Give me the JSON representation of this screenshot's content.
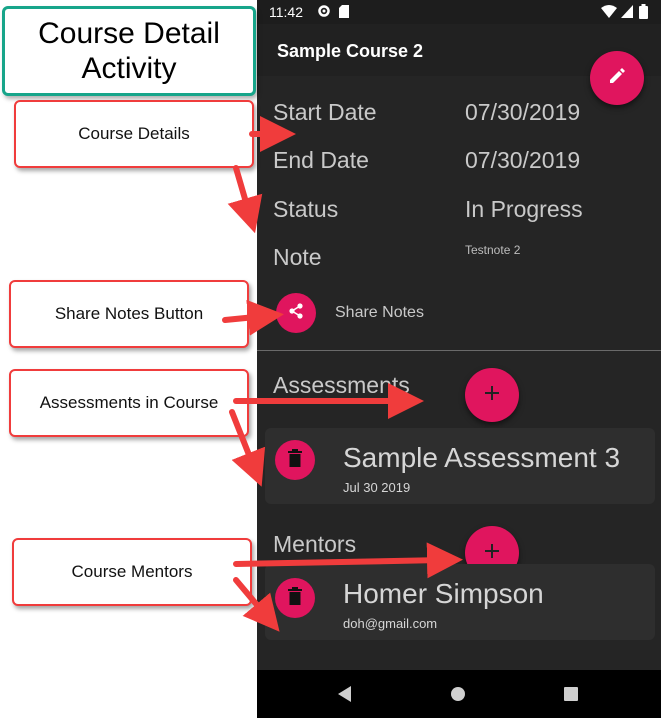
{
  "annotations": {
    "title_line1": "Course Detail",
    "title_line2": "Activity",
    "callouts": [
      "Course Details",
      "Share Notes Button",
      "Assessments in Course",
      "Course Mentors"
    ]
  },
  "status_bar": {
    "time": "11:42"
  },
  "app_bar": {
    "title": "Sample Course 2",
    "edit_icon": "pencil-icon"
  },
  "details": {
    "start_label": "Start Date",
    "start_value": "07/30/2019",
    "end_label": "End Date",
    "end_value": "07/30/2019",
    "status_label": "Status",
    "status_value": "In Progress",
    "note_label": "Note",
    "note_value": "Testnote 2"
  },
  "share": {
    "label": "Share Notes",
    "icon": "share-icon"
  },
  "assessments": {
    "section_title": "Assessments",
    "items": [
      {
        "title": "Sample Assessment 3",
        "date": "Jul 30 2019"
      }
    ]
  },
  "mentors": {
    "section_title": "Mentors",
    "items": [
      {
        "name": "Homer Simpson",
        "email": "doh@gmail.com"
      }
    ]
  },
  "colors": {
    "accent": "#e0155e",
    "arrow": "#f03c3c",
    "title_border": "#17a58a",
    "background": "#252525"
  }
}
